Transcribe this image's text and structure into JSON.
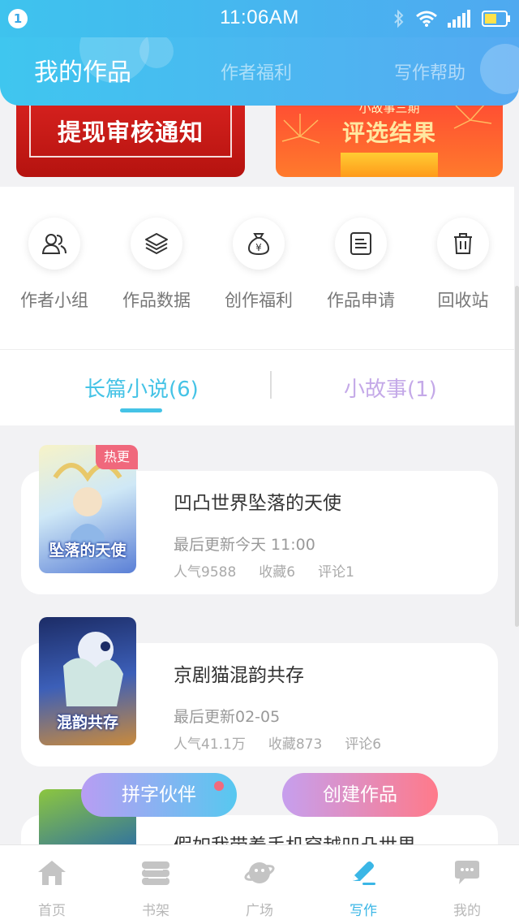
{
  "status_bar": {
    "notification_count": "1",
    "time": "11:06AM"
  },
  "header": {
    "tabs": [
      {
        "label": "我的作品",
        "active": true
      },
      {
        "label": "作者福利",
        "active": false
      },
      {
        "label": "写作帮助",
        "active": false
      }
    ]
  },
  "banners": [
    {
      "title": "提现审核通知",
      "subtitle": ""
    },
    {
      "title": "评选结果",
      "subtitle": "小故事三期"
    }
  ],
  "quick_actions": [
    {
      "label": "作者小组",
      "icon": "group-icon"
    },
    {
      "label": "作品数据",
      "icon": "layers-icon"
    },
    {
      "label": "创作福利",
      "icon": "money-bag-icon"
    },
    {
      "label": "作品申请",
      "icon": "document-icon"
    },
    {
      "label": "回收站",
      "icon": "trash-icon"
    }
  ],
  "work_tabs": [
    {
      "label": "长篇小说(6)",
      "active": true
    },
    {
      "label": "小故事(1)",
      "active": false
    }
  ],
  "works": [
    {
      "title": "凹凸世界坠落的天使",
      "cover_text": "坠落的天使",
      "badge": "热更",
      "update": "最后更新今天 11:00",
      "popularity": "人气9588",
      "favorites": "收藏6",
      "comments": "评论1"
    },
    {
      "title": "京剧猫混韵共存",
      "cover_text": "混韵共存",
      "badge": "",
      "update": "最后更新02-05",
      "popularity": "人气41.1万",
      "favorites": "收藏873",
      "comments": "评论6"
    },
    {
      "title": "假如我带着手机穿越凹凸世界",
      "cover_text": "",
      "badge": "",
      "update": "",
      "popularity": "",
      "favorites": "",
      "comments": ""
    }
  ],
  "floating_buttons": {
    "partner": "拼字伙伴",
    "create": "创建作品"
  },
  "bottom_nav": [
    {
      "label": "首页",
      "icon": "home-icon",
      "active": false
    },
    {
      "label": "书架",
      "icon": "bookshelf-icon",
      "active": false
    },
    {
      "label": "广场",
      "icon": "planet-icon",
      "active": false
    },
    {
      "label": "写作",
      "icon": "pen-icon",
      "active": true
    },
    {
      "label": "我的",
      "icon": "chat-bubble-icon",
      "active": false
    }
  ],
  "colors": {
    "accent": "#45c3e6",
    "header_gradient_start": "#3fc6ef",
    "header_gradient_end": "#56aaf2",
    "hot_badge": "#f0687c",
    "inactive_tab": "#c4a9e8"
  }
}
